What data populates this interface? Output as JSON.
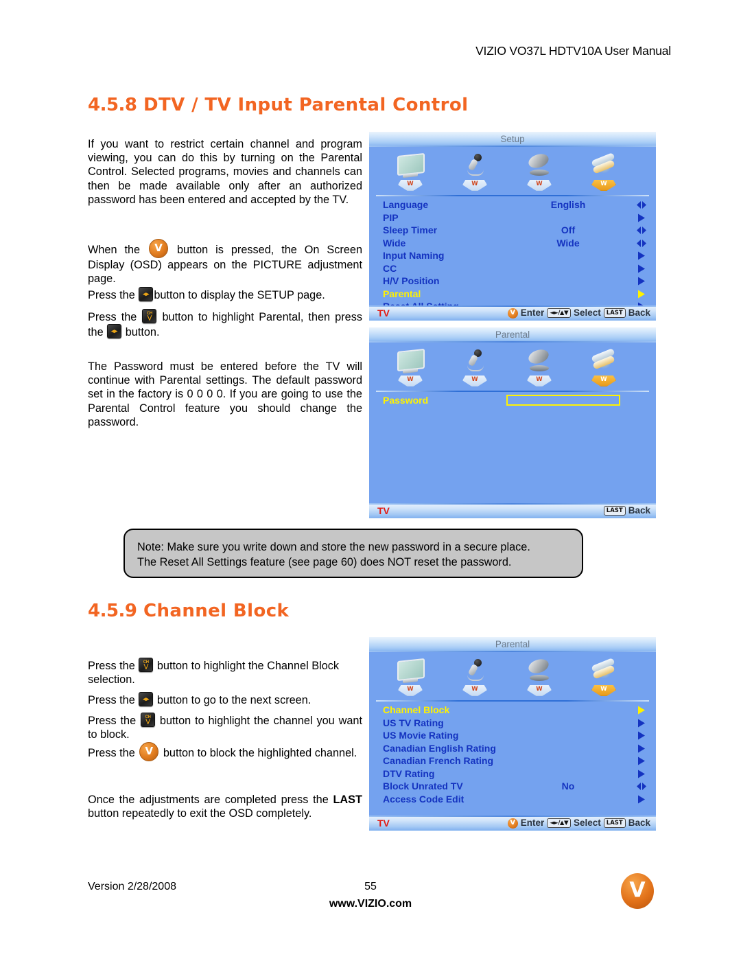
{
  "header": {
    "title": "VIZIO VO37L HDTV10A User Manual"
  },
  "sections": [
    {
      "number": "4.5.8",
      "title": "DTV / TV Input Parental Control"
    },
    {
      "number": "4.5.9",
      "title": "Channel Block"
    }
  ],
  "body": {
    "p1": "If you want to restrict certain channel and program viewing, you can do this by turning on the Parental Control.  Selected programs, movies and channels can then be made available only after an authorized password has been entered and accepted by the TV.",
    "p2_a": "When the",
    "p2_b": "button is pressed, the On Screen Display (OSD) appears on the PICTURE adjustment page.",
    "p3_a": "Press the",
    "p3_b": "button to display the SETUP page.",
    "p4_a": "Press the",
    "p4_b": "button to highlight Parental, then press the",
    "p4_c": "button.",
    "p5": "The Password must be entered before the TV will continue with Parental settings.  The default password set in the factory is 0 0 0 0.  If you are going to use the Parental Control feature you should change the password.",
    "p6_a": "Press the",
    "p6_b": "button to highlight the Channel Block selection.",
    "p7_a": "Press the",
    "p7_b": "button to go to the next screen.",
    "p8_a": "Press the",
    "p8_b": "button to highlight the channel you want to block.",
    "p9_a": "Press the",
    "p9_b": "button to block the highlighted channel.",
    "p10_a": "Once the adjustments are completed press the",
    "p10_bold": "LAST",
    "p10_b": "button repeatedly to exit the OSD completely."
  },
  "note": {
    "line1": "Note: Make sure you write down and store the new password in a secure place.",
    "line2": "The Reset All Settings feature (see page 60) does NOT reset the password."
  },
  "osd_common": {
    "tabs": [
      "picture-monitor-icon",
      "audio-microphone-icon",
      "tuner-dish-icon",
      "setup-wrench-icon"
    ],
    "tab_letter": "W",
    "tv_label": "TV",
    "enter_label": "Enter",
    "select_label": "Select",
    "back_label": "Back",
    "last_key": "LAST",
    "select_key": "◄►/▲▼",
    "highlight_color": "#FFF200",
    "text_color": "#1433C0",
    "bg_color": "#74A2EF"
  },
  "osd_setup": {
    "title": "Setup",
    "rows": [
      {
        "label": "Language",
        "value": "English",
        "arrow": "leftright"
      },
      {
        "label": "PIP",
        "value": "",
        "arrow": "right"
      },
      {
        "label": "Sleep Timer",
        "value": "Off",
        "arrow": "leftright"
      },
      {
        "label": "Wide",
        "value": "Wide",
        "arrow": "leftright"
      },
      {
        "label": "Input Naming",
        "value": "",
        "arrow": "right"
      },
      {
        "label": "CC",
        "value": "",
        "arrow": "right"
      },
      {
        "label": "H/V Position",
        "value": "",
        "arrow": "right"
      },
      {
        "label": "Parental",
        "value": "",
        "arrow": "right",
        "highlight": true
      },
      {
        "label": "Reset All Setting",
        "value": "",
        "arrow": "right"
      }
    ]
  },
  "osd_password": {
    "title": "Parental",
    "password_label": "Password",
    "password_value": ""
  },
  "osd_parental": {
    "title": "Parental",
    "rows": [
      {
        "label": "Channel Block",
        "value": "",
        "arrow": "right",
        "highlight": true
      },
      {
        "label": "US TV Rating",
        "value": "",
        "arrow": "right"
      },
      {
        "label": "US Movie Rating",
        "value": "",
        "arrow": "right"
      },
      {
        "label": "Canadian English Rating",
        "value": "",
        "arrow": "right"
      },
      {
        "label": "Canadian French Rating",
        "value": "",
        "arrow": "right"
      },
      {
        "label": "DTV Rating",
        "value": "",
        "arrow": "right"
      },
      {
        "label": "Block Unrated TV",
        "value": "No",
        "arrow": "leftright"
      },
      {
        "label": "Access Code Edit",
        "value": "",
        "arrow": "right"
      }
    ]
  },
  "footer": {
    "version": "Version 2/28/2008",
    "page_number": "55",
    "url": "www.VIZIO.com"
  }
}
